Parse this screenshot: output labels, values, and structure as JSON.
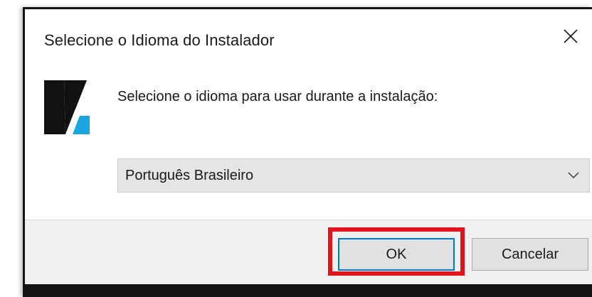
{
  "dialog": {
    "title": "Selecione o Idioma do Instalador",
    "close_icon": "close-icon",
    "logo_icon": "installer-logo-icon",
    "prompt": "Selecione o idioma para usar durante a instalação:",
    "language_select": {
      "selected": "Português Brasileiro",
      "chevron_icon": "chevron-down-icon"
    },
    "buttons": {
      "ok": "OK",
      "cancel": "Cancelar"
    }
  },
  "annotation": {
    "highlight_color": "#e0141c",
    "target": "ok-button"
  },
  "colors": {
    "ok_focus_border": "#0078d7",
    "logo_dark": "#111111",
    "logo_accent": "#1aa6e0"
  }
}
